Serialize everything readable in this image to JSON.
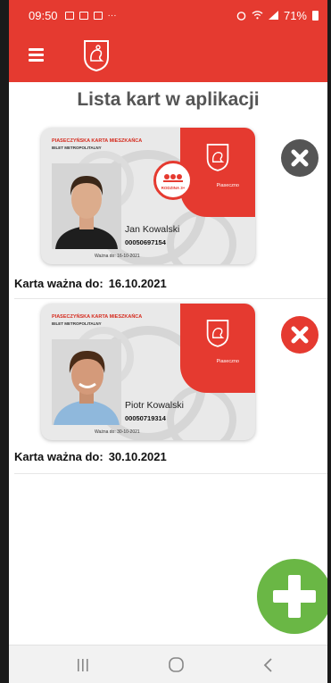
{
  "status": {
    "time": "09:50",
    "battery": "71%"
  },
  "page": {
    "title": "Lista kart w aplikacji"
  },
  "cards": [
    {
      "header": "PIASECZYŃSKA KARTA MIESZKAŃCA",
      "subheader": "BILET METROPOLITALNY",
      "name": "Jan Kowalski",
      "number": "00050697154",
      "valid_small": "Ważna do: 16-10-2021",
      "validity_label": "Karta ważna do:",
      "validity_date": "16.10.2021",
      "badge": "RODZINA 3+",
      "city": "Piaseczno",
      "delete_color": "#555555"
    },
    {
      "header": "PIASECZYŃSKA KARTA MIESZKAŃCA",
      "subheader": "BILET METROPOLITALNY",
      "name": "Piotr Kowalski",
      "number": "00050719314",
      "valid_small": "Ważna do: 30-10-2021",
      "validity_label": "Karta ważna do:",
      "validity_date": "30.10.2021",
      "city": "Piaseczno",
      "delete_color": "#e53a30"
    }
  ],
  "colors": {
    "brand": "#e53a30",
    "fab": "#6ab745"
  },
  "icons": {
    "menu": "hamburger-menu-icon",
    "logo": "piaseczno-crest-icon",
    "delete": "close-icon",
    "add": "plus-icon",
    "nav_recent": "recent-apps-icon",
    "nav_home": "home-icon",
    "nav_back": "back-icon"
  }
}
